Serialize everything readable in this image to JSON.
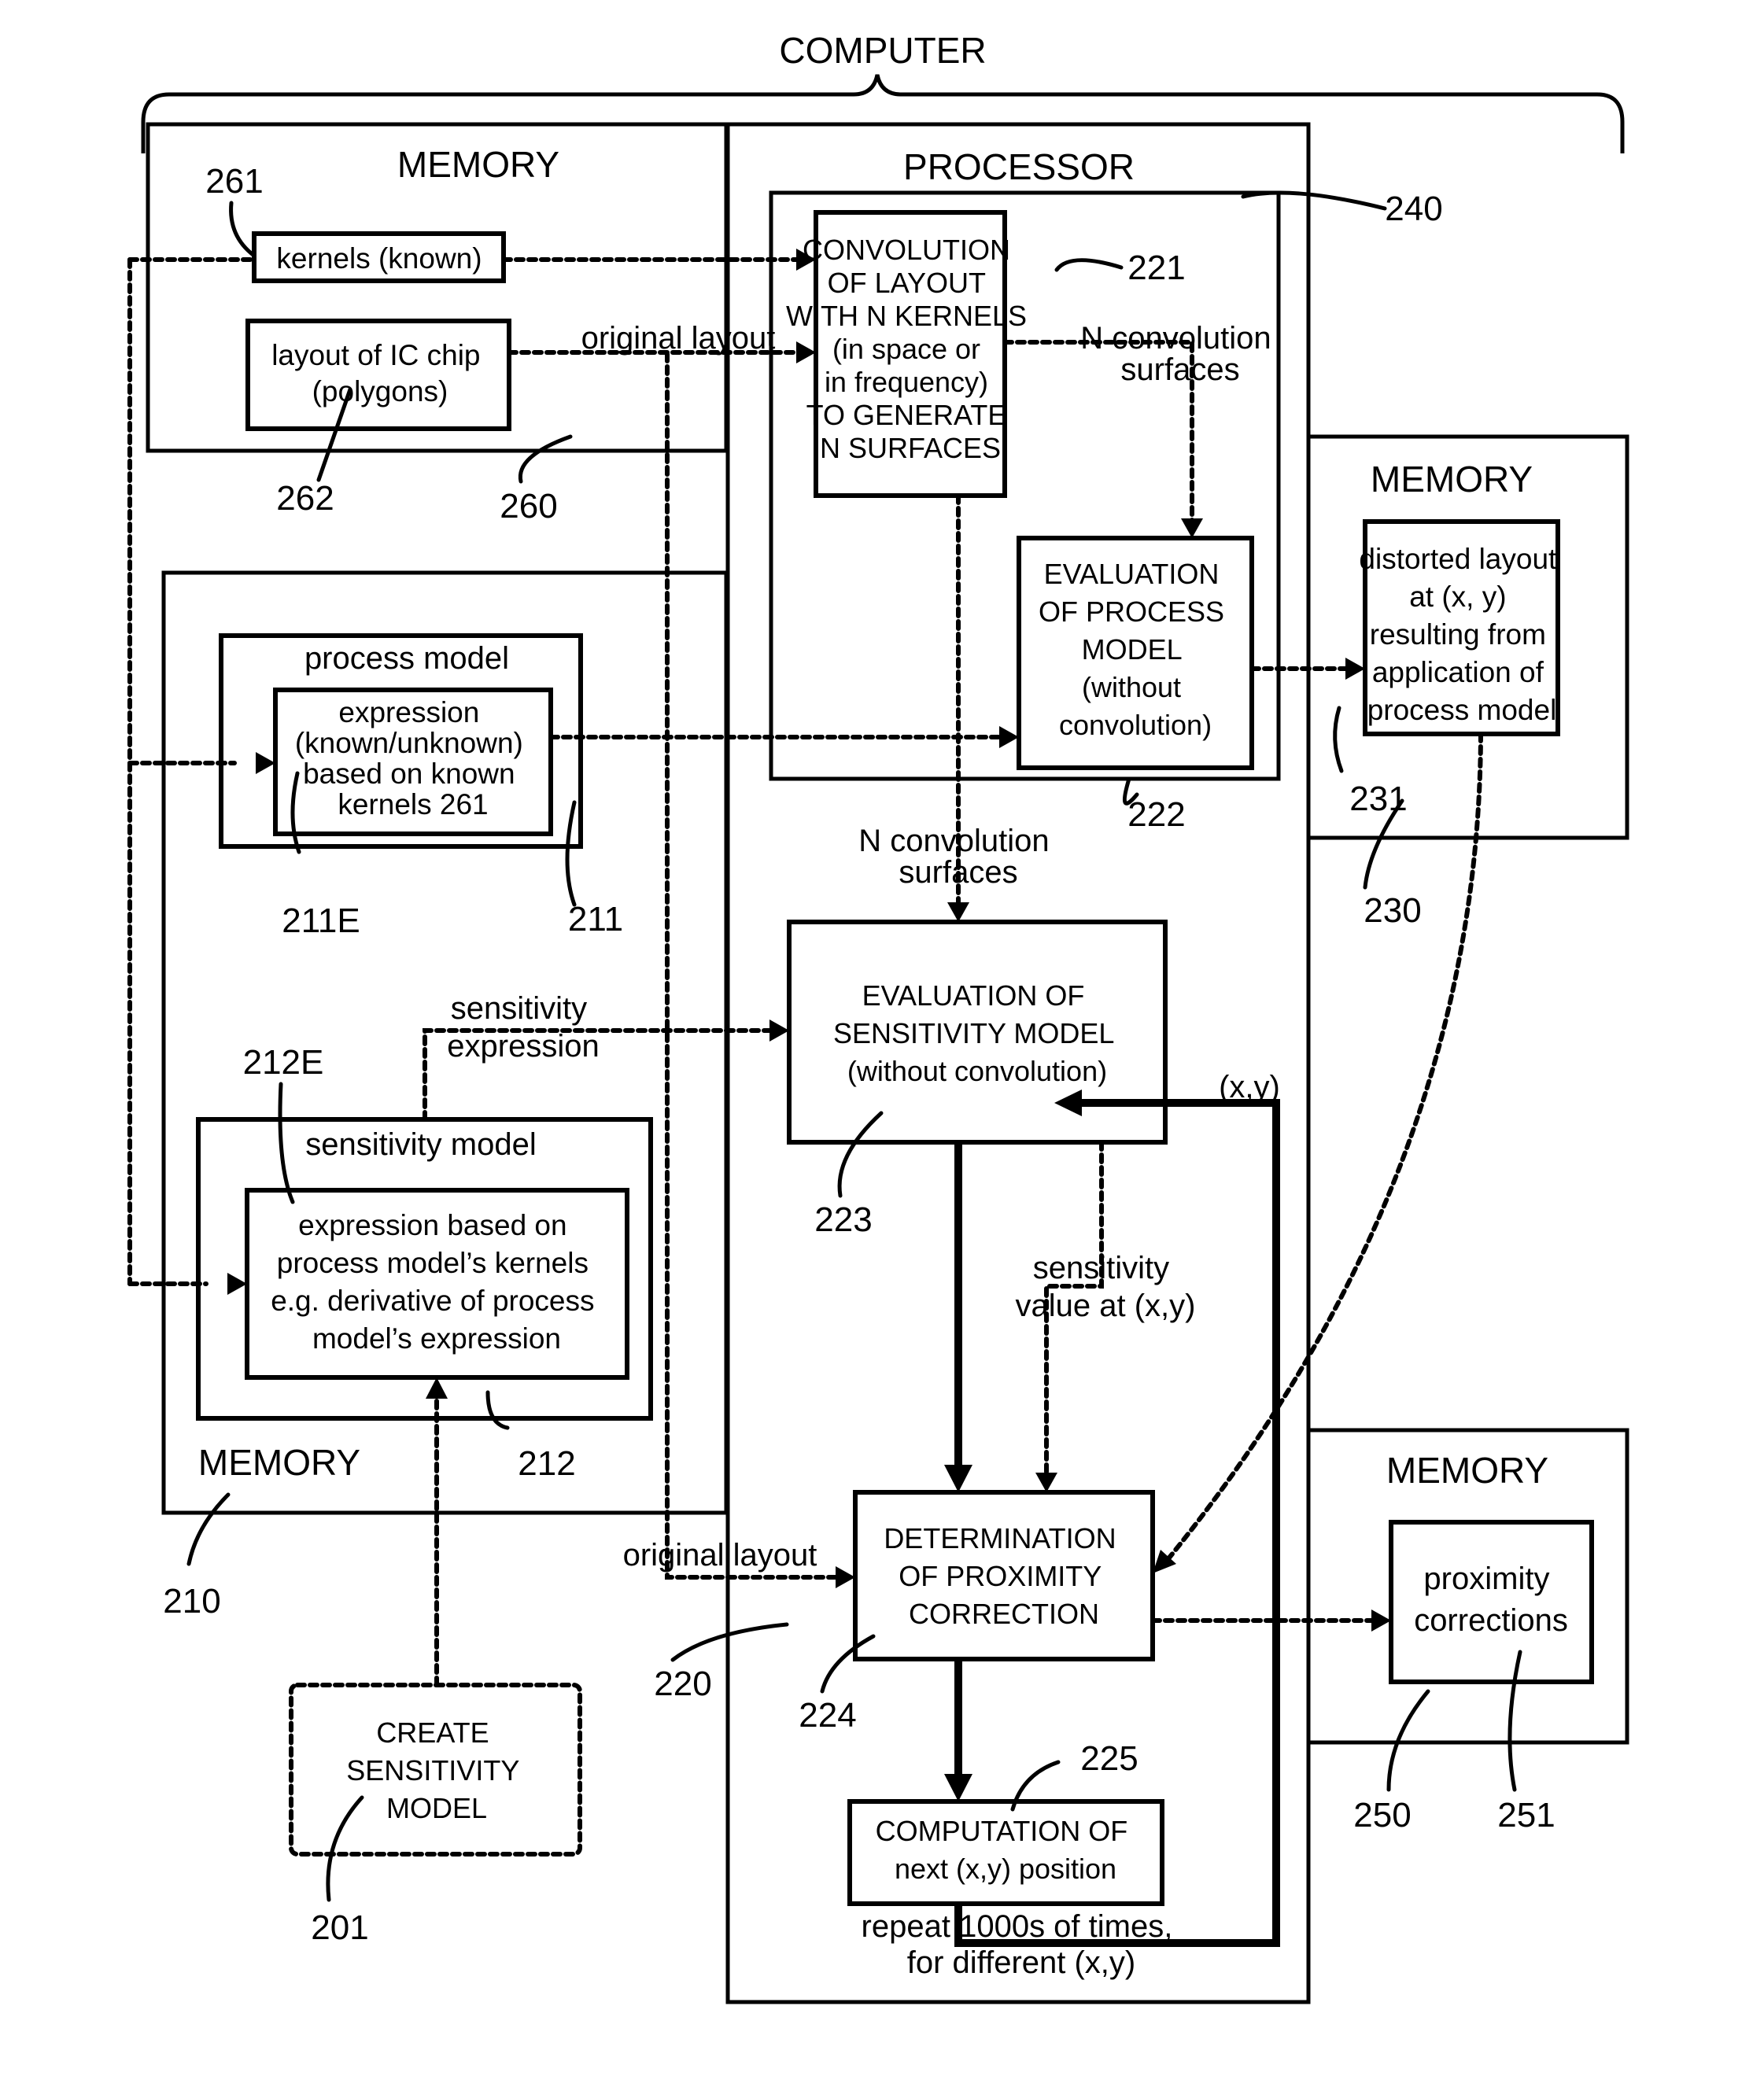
{
  "computer_label": "COMPUTER",
  "memory_260": {
    "title": "MEMORY",
    "ref": "260",
    "kernels": {
      "text": "kernels (known)",
      "ref": "261"
    },
    "layout": {
      "lines": [
        "layout of IC chip",
        "(polygons)"
      ],
      "ref": "262"
    }
  },
  "memory_210": {
    "title": "MEMORY",
    "ref": "210",
    "process_model": {
      "title": "process model",
      "ref": "211",
      "expression": {
        "lines": [
          "expression",
          "(known/unknown)",
          "based on known",
          "kernels 261"
        ],
        "ref": "211E"
      }
    },
    "sensitivity_model": {
      "title": "sensitivity model",
      "ref": "212",
      "expression": {
        "lines": [
          "expression based on",
          "process model’s kernels",
          "e.g. derivative of process",
          "model’s expression"
        ],
        "ref": "212E"
      }
    }
  },
  "processor": {
    "title": "PROCESSOR",
    "ref": "220",
    "group_ref": "240",
    "convolution": {
      "lines": [
        "CONVOLUTION",
        "OF LAYOUT",
        "WITH N KERNELS",
        "(in space or",
        "in frequency)",
        "TO GENERATE",
        "N SURFACES"
      ],
      "ref": "221"
    },
    "eval_process": {
      "lines": [
        "EVALUATION",
        "OF PROCESS",
        "MODEL",
        "(without",
        "convolution)"
      ],
      "ref": "222"
    },
    "eval_sensitivity": {
      "lines": [
        "EVALUATION OF",
        "SENSITIVITY MODEL",
        "(without convolution)"
      ],
      "ref": "223"
    },
    "determination": {
      "lines": [
        "DETERMINATION",
        "OF PROXIMITY",
        "CORRECTION"
      ],
      "ref": "224"
    },
    "computation": {
      "lines": [
        "COMPUTATION OF",
        "next (x,y) position"
      ],
      "ref": "225"
    }
  },
  "memory_230": {
    "title": "MEMORY",
    "ref": "230",
    "distorted": {
      "lines": [
        "distorted layout",
        "at (x, y)",
        "resulting from",
        "application of",
        "process model"
      ],
      "ref": "231"
    }
  },
  "memory_250": {
    "title": "MEMORY",
    "ref": "250",
    "corrections": {
      "lines": [
        "proximity",
        "corrections"
      ],
      "ref": "251"
    }
  },
  "create_sensitivity": {
    "lines": [
      "CREATE",
      "SENSITIVITY",
      "MODEL"
    ],
    "ref": "201"
  },
  "edge_labels": {
    "original_layout_top": "original layout",
    "n_conv_top": [
      "N convolution",
      "surfaces"
    ],
    "n_conv_mid": [
      "N convolution",
      "surfaces"
    ],
    "sensitivity_expression": [
      "sensitivity",
      "expression"
    ],
    "sensitivity_value": [
      "sensitivity",
      "value at (x,y)"
    ],
    "xy": "(x,y)",
    "original_layout_bottom": "original layout",
    "repeat": [
      "repeat 1000s of times,",
      "for different (x,y)"
    ]
  }
}
